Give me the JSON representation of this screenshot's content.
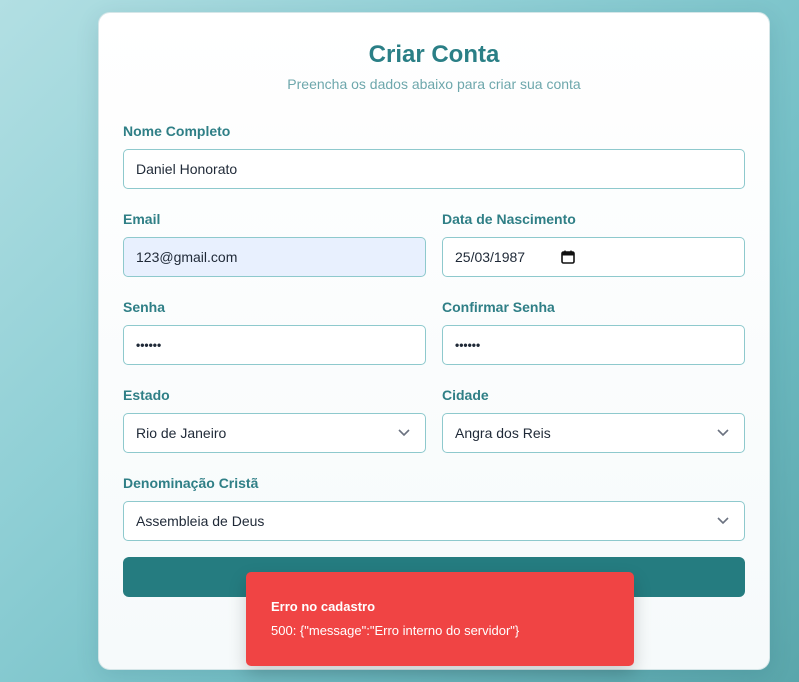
{
  "form": {
    "title": "Criar Conta",
    "subtitle": "Preencha os dados abaixo para criar sua conta",
    "full_name": {
      "label": "Nome Completo",
      "value": "Daniel Honorato"
    },
    "email": {
      "label": "Email",
      "value": "123@gmail.com"
    },
    "birth_date": {
      "label": "Data de Nascimento",
      "value": "25/03/1987"
    },
    "password": {
      "label": "Senha",
      "value": "••••••"
    },
    "confirm_password": {
      "label": "Confirmar Senha",
      "value": "••••••"
    },
    "state": {
      "label": "Estado",
      "selected": "Rio de Janeiro"
    },
    "city": {
      "label": "Cidade",
      "selected": "Angra dos Reis"
    },
    "denomination": {
      "label": "Denominação Cristã",
      "selected": "Assembleia de Deus"
    },
    "submit_label": ""
  },
  "toast": {
    "title": "Erro no cadastro",
    "message": "500: {\"message\":\"Erro interno do servidor\"}"
  },
  "colors": {
    "accent": "#2a7f86",
    "button": "#257c80",
    "error": "#f04444",
    "autofill": "#e8f0fe"
  }
}
